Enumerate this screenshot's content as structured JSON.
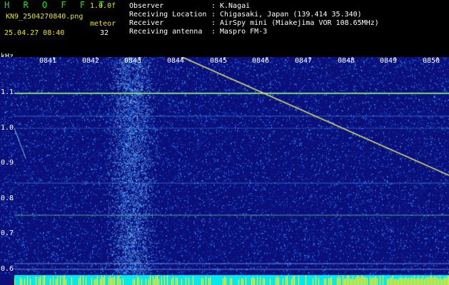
{
  "header": {
    "app_title": "H R O F F T",
    "version": "1.0.0f",
    "filename": "KN9_2504270840.png",
    "meteor_label": "meteor",
    "datetime": "25.04.27 08:40",
    "meteor_count": "32"
  },
  "meta": [
    {
      "label": "Observer",
      "value": "K.Nagai"
    },
    {
      "label": "Receiving Location",
      "value": "Chigasaki, Japan (139.414 35.340)"
    },
    {
      "label": "Receiver",
      "value": "AirSpy mini (Miakejima VOR 108.65MHz)"
    },
    {
      "label": "Receiving antenna",
      "value": "Maspro FM-3"
    }
  ],
  "separator": ":",
  "y_axis": {
    "unit": "kHz",
    "ticks": [
      "1.1",
      "1.0",
      "0.9",
      "0.8",
      "0.7",
      "0.6"
    ]
  },
  "time_axis": {
    "ticks": [
      "0841",
      "0842",
      "0843",
      "0844",
      "0845",
      "0846",
      "0847",
      "0848",
      "0849",
      "0850"
    ]
  },
  "colors": {
    "background": "#0a0f7a",
    "noise_high": "#2a8cff",
    "line": "#7fe07f",
    "trace": "#e6e66a",
    "bar": "#00e8f0",
    "bar_high": "#ffff40"
  }
}
